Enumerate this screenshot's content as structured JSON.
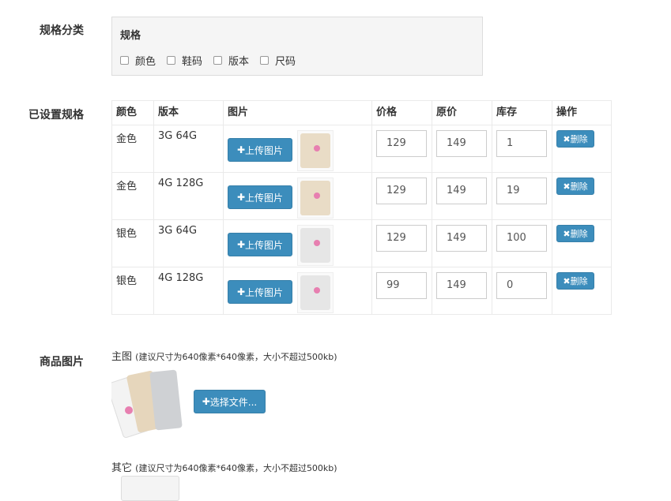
{
  "labels": {
    "spec_category": "规格分类",
    "set_specs": "已设置规格",
    "product_images": "商品图片"
  },
  "spec_box": {
    "title": "规格",
    "options": [
      "颜色",
      "鞋码",
      "版本",
      "尺码"
    ]
  },
  "table": {
    "headers": [
      "颜色",
      "版本",
      "图片",
      "价格",
      "原价",
      "库存",
      "操作"
    ],
    "upload_label": "上传图片",
    "delete_label": "删除",
    "rows": [
      {
        "color": "金色",
        "version": "3G 64G",
        "price": "129",
        "orig": "149",
        "stock": "1",
        "phone_color": "#e9dcc6"
      },
      {
        "color": "金色",
        "version": "4G 128G",
        "price": "129",
        "orig": "149",
        "stock": "19",
        "phone_color": "#e9dcc6"
      },
      {
        "color": "银色",
        "version": "3G 64G",
        "price": "129",
        "orig": "149",
        "stock": "100",
        "phone_color": "#e6e6e6"
      },
      {
        "color": "银色",
        "version": "4G 128G",
        "price": "99",
        "orig": "149",
        "stock": "0",
        "phone_color": "#e6e6e6"
      }
    ]
  },
  "images": {
    "main_label": "主图",
    "main_hint": "(建议尺寸为640像素*640像素，大小不超过500kb)",
    "choose_file": "选择文件...",
    "other_label": "其它",
    "other_hint": "(建议尺寸为640像素*640像素，大小不超过500kb)"
  },
  "colors": {
    "accent": "#3c8dbc",
    "gold_phone": "#e9dcc6",
    "silver_phone": "#e6e6e6",
    "flower": "#e77fb0"
  },
  "icons": {
    "plus": "plus-icon",
    "close": "close-icon"
  }
}
